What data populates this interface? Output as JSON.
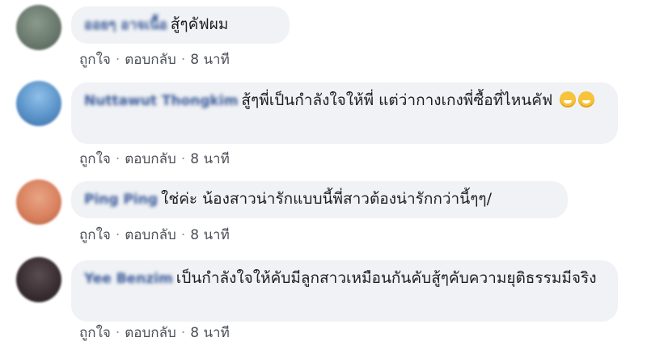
{
  "comments": [
    {
      "author": "ออยๆ อาจเนื้อ",
      "text": "สู้ๆคัฟผม",
      "emoji_count": 0,
      "like": "ถูกใจ",
      "reply": "ตอบกลับ",
      "time": "8 นาที",
      "avatar_color": "#6b7a6e"
    },
    {
      "author": "Nuttawut Thongkim",
      "text": "สู้ๆพี่เป็นกำลังใจให้พี่ แต่ว่ากางเกงพี่ซื้อที่ไหนคัฟ",
      "emoji_count": 2,
      "like": "ถูกใจ",
      "reply": "ตอบกลับ",
      "time": "8 นาที",
      "avatar_color": "#5b93c9"
    },
    {
      "author": "Ping Ping",
      "text": "ใช่ค่ะ น้องสาวน่ารักแบบนี้พี่สาวต้องน่ารักกว่านี้ๆๆ/",
      "emoji_count": 0,
      "like": "ถูกใจ",
      "reply": "ตอบกลับ",
      "time": "8 นาที",
      "avatar_color": "#d9825f"
    },
    {
      "author": "Yee Benzim",
      "text": "เป็นกำลังใจให้คับมีลูกสาวเหมือนกันคับสู้ๆคับความยุติธรรมมีจริง",
      "emoji_count": 0,
      "like": "ถูกใจ",
      "reply": "ตอบกลับ",
      "time": "8 นาที",
      "avatar_color": "#3a2f33"
    }
  ]
}
